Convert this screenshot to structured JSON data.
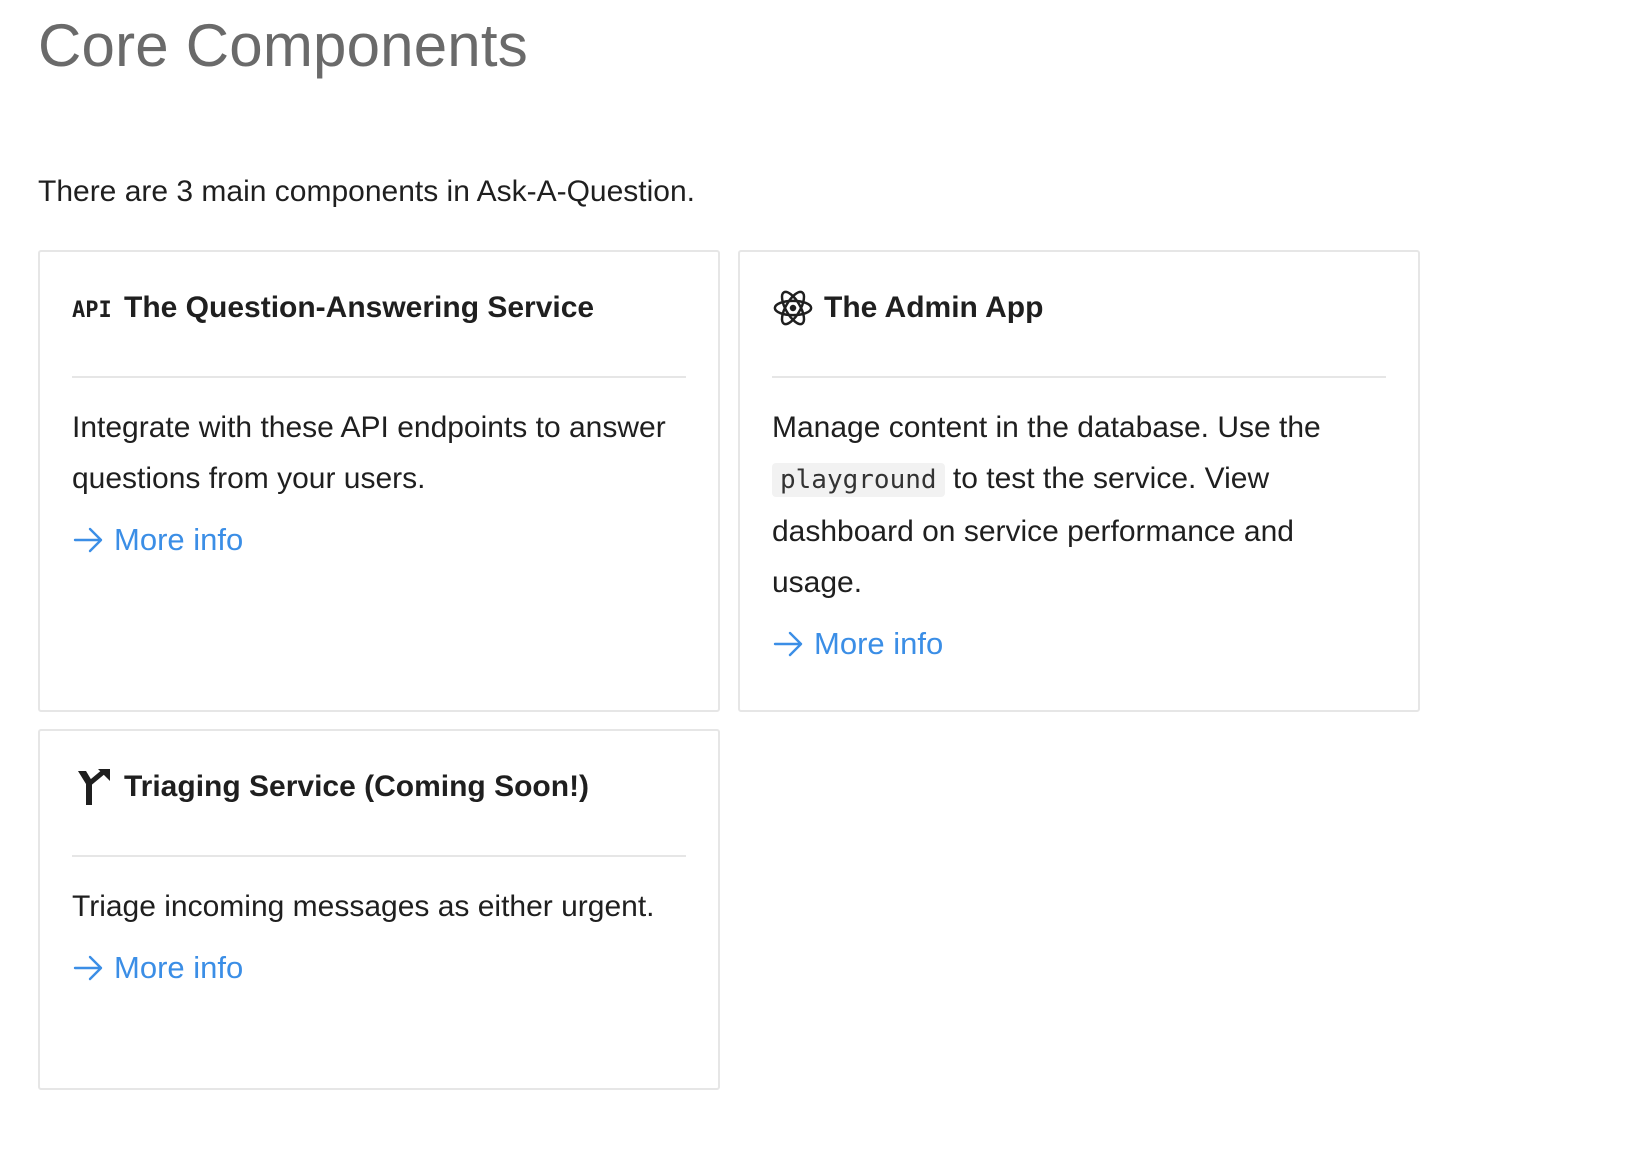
{
  "page": {
    "title": "Core Components",
    "intro": "There are 3 main components in Ask-A-Question."
  },
  "cards": [
    {
      "icon": "api-icon",
      "title": "The Question-Answering Service",
      "body": "Integrate with these API endpoints to answer questions from your users.",
      "link_label": "More info"
    },
    {
      "icon": "react-atom-icon",
      "title": "The Admin App",
      "body_before": "Manage content in the database. Use the",
      "body_code": "playground",
      "body_after": "to test the service. View dashboard on service performance and usage.",
      "link_label": "More info"
    },
    {
      "icon": "triage-split-icon",
      "title": "Triaging Service (Coming Soon!)",
      "body": "Triage incoming messages as either urgent.",
      "link_label": "More info"
    }
  ],
  "colors": {
    "title_gray": "#6a6a6a",
    "text": "#1f1f1f",
    "link": "#3b8ee6",
    "border": "#e6e6e6"
  }
}
